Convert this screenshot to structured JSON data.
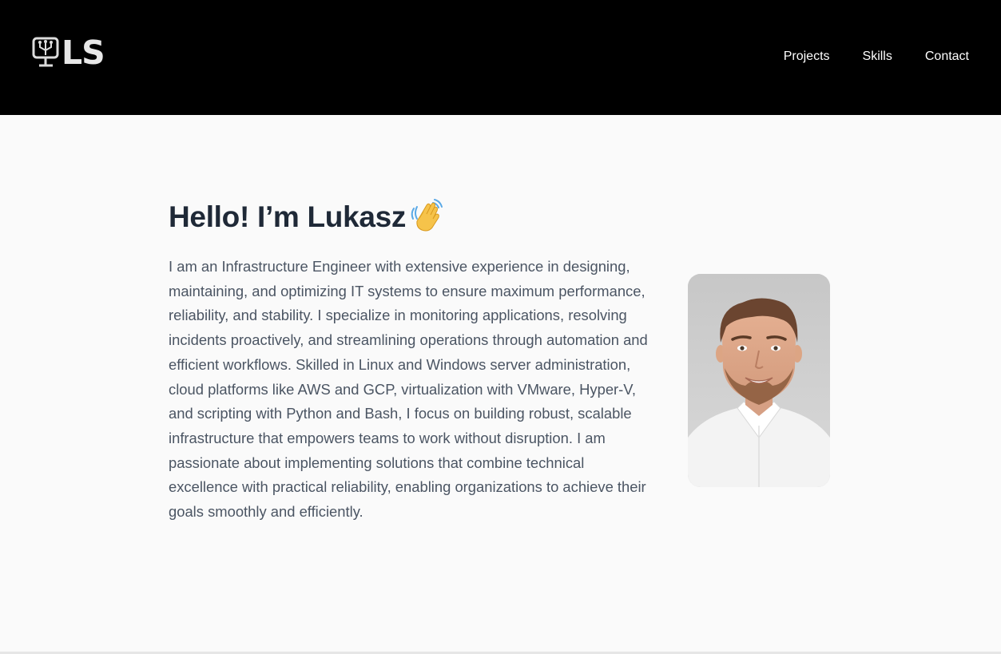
{
  "header": {
    "logo": {
      "text": "LS",
      "icon": "monitor-circuit-icon"
    },
    "nav": [
      {
        "label": "Projects"
      },
      {
        "label": "Skills"
      },
      {
        "label": "Contact"
      }
    ]
  },
  "hero": {
    "title": "Hello! I’m Lukasz",
    "title_icon": "waving-hand-icon",
    "bio": "I am an Infrastructure Engineer with extensive experience in designing, maintaining, and optimizing IT systems to ensure maximum performance, reliability, and stability. I specialize in monitoring applications, resolving incidents proactively, and streamlining operations through automation and efficient workflows. Skilled in Linux and Windows server administration, cloud platforms like AWS and GCP, virtualization with VMware, Hyper-V, and scripting with Python and Bash, I focus on building robust, scalable infrastructure that empowers teams to work without disruption. I am passionate about implementing solutions that combine technical excellence with practical reliability, enabling organizations to achieve their goals smoothly and efficiently.",
    "photo_icon": "profile-photo"
  },
  "colors": {
    "header_bg": "#000000",
    "page_bg": "#fafafa",
    "title": "#1f2937",
    "body_text": "#4b5563",
    "nav_text": "#ffffff"
  }
}
